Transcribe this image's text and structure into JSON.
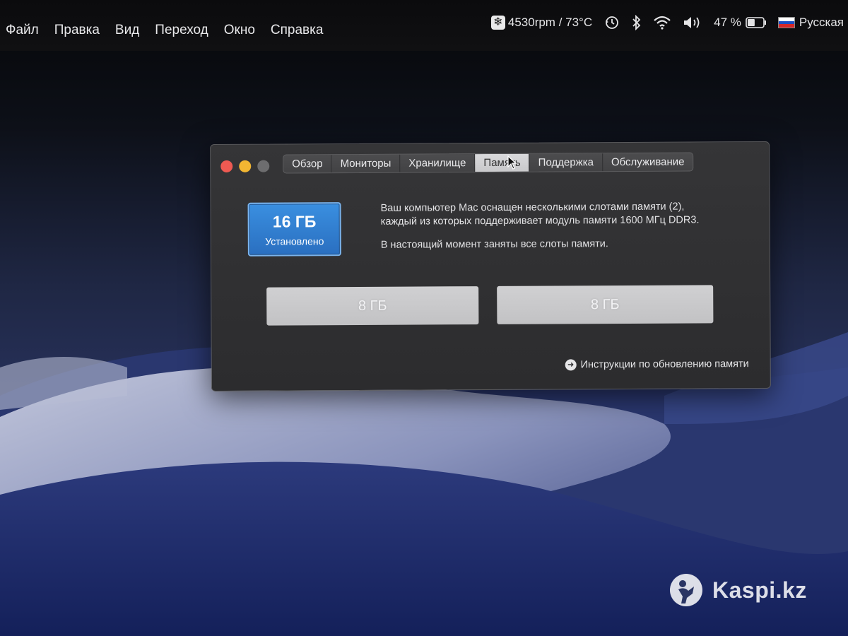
{
  "menubar": {
    "items": [
      "Файл",
      "Правка",
      "Вид",
      "Переход",
      "Окно",
      "Справка"
    ],
    "status": {
      "fan_icon": "fan-icon",
      "fan_text": "4530rpm / 73°C",
      "time_machine_icon": "time-machine-icon",
      "bluetooth_icon": "bluetooth-icon",
      "wifi_icon": "wifi-icon",
      "volume_icon": "volume-icon",
      "battery_percent": "47 %",
      "battery_icon": "battery-icon",
      "battery_level": 0.47,
      "language": "Русская",
      "flag_icon": "russian-flag-icon"
    }
  },
  "window": {
    "traffic_lights": {
      "close": "#ee5a52",
      "minimize": "#f2b632",
      "zoom": "#6d6d6f"
    },
    "tabs": [
      {
        "label": "Обзор",
        "active": false
      },
      {
        "label": "Мониторы",
        "active": false
      },
      {
        "label": "Хранилище",
        "active": false
      },
      {
        "label": "Память",
        "active": true
      },
      {
        "label": "Поддержка",
        "active": false
      },
      {
        "label": "Обслуживание",
        "active": false
      }
    ],
    "memory": {
      "total": "16 ГБ",
      "installed_label": "Установлено",
      "description_line1": "Ваш компьютер Mac оснащен несколькими слотами памяти (2),",
      "description_line2": "каждый из которых поддерживает модуль памяти 1600 МГц DDR3.",
      "description_line3": "В настоящий момент заняты все слоты памяти.",
      "slots": [
        "8 ГБ",
        "8 ГБ"
      ],
      "upgrade_link": "Инструкции по обновлению памяти"
    }
  },
  "watermark": {
    "text": "Kaspi.kz"
  },
  "colors": {
    "accent": "#2a7fd6",
    "window_bg": "#303032"
  }
}
